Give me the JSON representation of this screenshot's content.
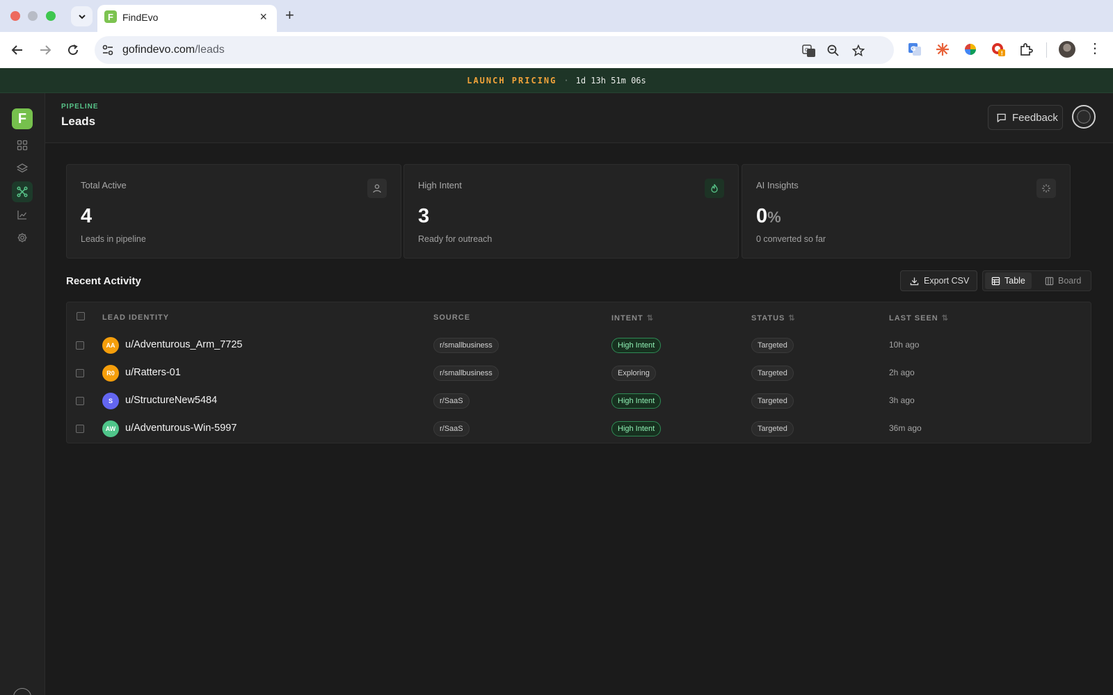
{
  "browser": {
    "tab_title": "FindEvo",
    "url_host": "gofindevo.com",
    "url_path": "/leads"
  },
  "promo": {
    "label": "LAUNCH PRICING",
    "separator": "·",
    "countdown": "1d 13h 51m 06s"
  },
  "sidebar": {
    "logo_letter": "F",
    "items": [
      {
        "name": "dashboard",
        "icon": "grid-icon",
        "active": false
      },
      {
        "name": "layers",
        "icon": "layers-icon",
        "active": false
      },
      {
        "name": "pipeline",
        "icon": "network-icon",
        "active": true
      },
      {
        "name": "analytics",
        "icon": "chart-icon",
        "active": false
      },
      {
        "name": "settings",
        "icon": "gear-icon",
        "active": false
      }
    ]
  },
  "header": {
    "eyebrow": "PIPELINE",
    "title": "Leads",
    "feedback_label": "Feedback"
  },
  "stats": [
    {
      "label": "Total Active",
      "value": "4",
      "unit": "",
      "sub": "Leads in pipeline",
      "icon": "user-icon"
    },
    {
      "label": "High Intent",
      "value": "3",
      "unit": "",
      "sub": "Ready for outreach",
      "icon": "flame-icon"
    },
    {
      "label": "AI Insights",
      "value": "0",
      "unit": "%",
      "sub": "0 converted so far",
      "icon": "sparkle-icon"
    }
  ],
  "activity": {
    "title": "Recent Activity",
    "export_label": "Export CSV",
    "view_table": "Table",
    "view_board": "Board",
    "columns": [
      "LEAD IDENTITY",
      "SOURCE",
      "INTENT",
      "STATUS",
      "LAST SEEN"
    ],
    "rows": [
      {
        "initials": "AA",
        "name": "u/Adventurous_Arm_7725",
        "source": "r/smallbusiness",
        "intent": "High Intent",
        "status": "Targeted",
        "last_seen": "10h ago",
        "avatar_color": "#f59e0b"
      },
      {
        "initials": "R0",
        "name": "u/Ratters-01",
        "source": "r/smallbusiness",
        "intent": "Exploring",
        "status": "Targeted",
        "last_seen": "2h ago",
        "avatar_color": "#f59e0b"
      },
      {
        "initials": "S",
        "name": "u/StructureNew5484",
        "source": "r/SaaS",
        "intent": "High Intent",
        "status": "Targeted",
        "last_seen": "3h ago",
        "avatar_color": "#6366f1"
      },
      {
        "initials": "AW",
        "name": "u/Adventurous-Win-5997",
        "source": "r/SaaS",
        "intent": "High Intent",
        "status": "Targeted",
        "last_seen": "36m ago",
        "avatar_color": "#4fc58a"
      }
    ]
  },
  "colors": {
    "accent_green": "#58c489",
    "promo_orange": "#f2a33a",
    "background": "#1b1b1b"
  }
}
